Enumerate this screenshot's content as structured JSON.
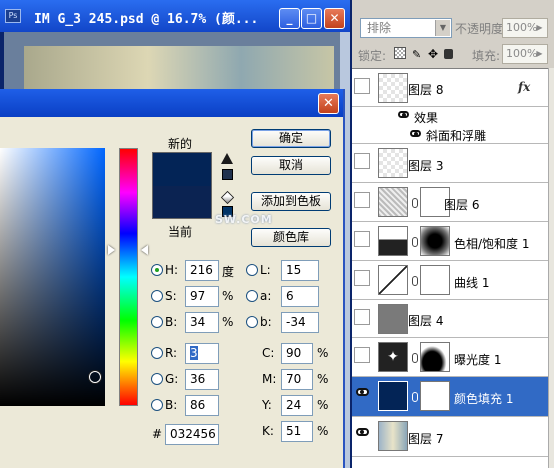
{
  "document": {
    "title": "IM G_3 245.psd @ 16.7% (颜...",
    "app_icon": "Ps",
    "watermark": "SW.COM"
  },
  "picker": {
    "new_label": "新的",
    "current_label": "当前",
    "new_color": "#032456",
    "current_color": "#0b2352",
    "buttons": {
      "ok": "确定",
      "cancel": "取消",
      "add_swatch": "添加到色板",
      "color_library": "颜色库"
    },
    "hsb": [
      {
        "label": "H:",
        "value": "216",
        "unit": "度",
        "checked": true
      },
      {
        "label": "S:",
        "value": "97",
        "unit": "%",
        "checked": false
      },
      {
        "label": "B:",
        "value": "34",
        "unit": "%",
        "checked": false
      }
    ],
    "lab": [
      {
        "label": "L:",
        "value": "15"
      },
      {
        "label": "a:",
        "value": "6"
      },
      {
        "label": "b:",
        "value": "-34"
      }
    ],
    "rgb": [
      {
        "label": "R:",
        "value": "3"
      },
      {
        "label": "G:",
        "value": "36"
      },
      {
        "label": "B:",
        "value": "86"
      }
    ],
    "cmyk": [
      {
        "label": "C:",
        "value": "90",
        "unit": "%"
      },
      {
        "label": "M:",
        "value": "70",
        "unit": "%"
      },
      {
        "label": "Y:",
        "value": "24",
        "unit": "%"
      },
      {
        "label": "K:",
        "value": "51",
        "unit": "%"
      }
    ],
    "hex_label": "#",
    "hex_value": "032456"
  },
  "layers_panel": {
    "blend_mode": "排除",
    "opacity_label": "不透明度:",
    "opacity_value": "100%",
    "lock_label": "锁定:",
    "fill_label": "填充:",
    "fill_value": "100%",
    "layers": [
      {
        "name": "图层 8",
        "fx": "fx"
      },
      {
        "name": "效果"
      },
      {
        "name": "斜面和浮雕"
      },
      {
        "name": "图层 3"
      },
      {
        "name": "图层 6"
      },
      {
        "name": "色相/饱和度 1"
      },
      {
        "name": "曲线 1"
      },
      {
        "name": "图层 4"
      },
      {
        "name": "曝光度 1"
      },
      {
        "name": "颜色填充 1"
      },
      {
        "name": "图层 7"
      }
    ]
  }
}
